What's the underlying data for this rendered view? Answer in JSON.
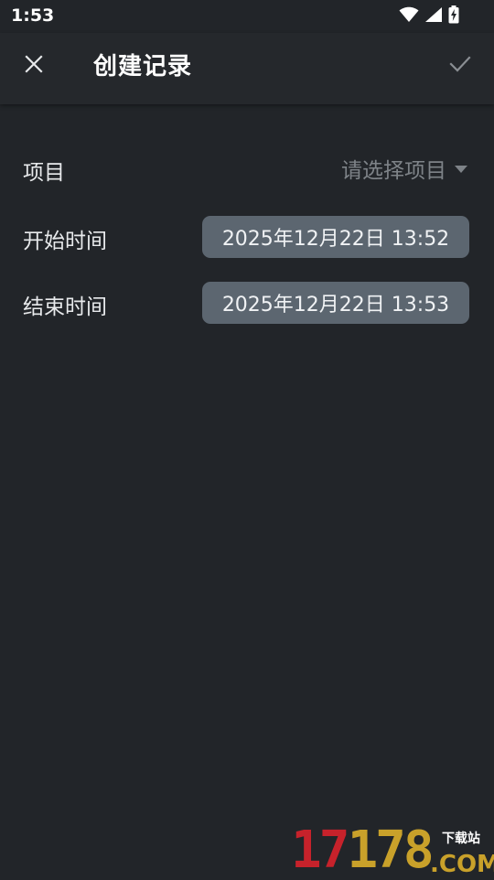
{
  "status_bar": {
    "time": "1:53",
    "icons": [
      "wifi-icon",
      "cellular-signal-icon",
      "battery-charging-icon"
    ]
  },
  "app_bar": {
    "title": "创建记录",
    "close_icon": "close-icon",
    "confirm_icon": "check-icon"
  },
  "form": {
    "project": {
      "label": "项目",
      "placeholder": "请选择项目",
      "dropdown_icon": "dropdown-arrow-icon"
    },
    "start_time": {
      "label": "开始时间",
      "value": "2025年12月22日 13:52"
    },
    "end_time": {
      "label": "结束时间",
      "value": "2025年12月22日 13:53"
    }
  },
  "watermark": {
    "number_red": "17",
    "number_gold": "178",
    "site_label": "下载站",
    "domain": ".COM"
  },
  "colors": {
    "background": "#222529",
    "chip": "#5c6670",
    "placeholder": "#7e8388",
    "watermark_red": "#c7222b",
    "watermark_gold": "#c9a12a"
  }
}
